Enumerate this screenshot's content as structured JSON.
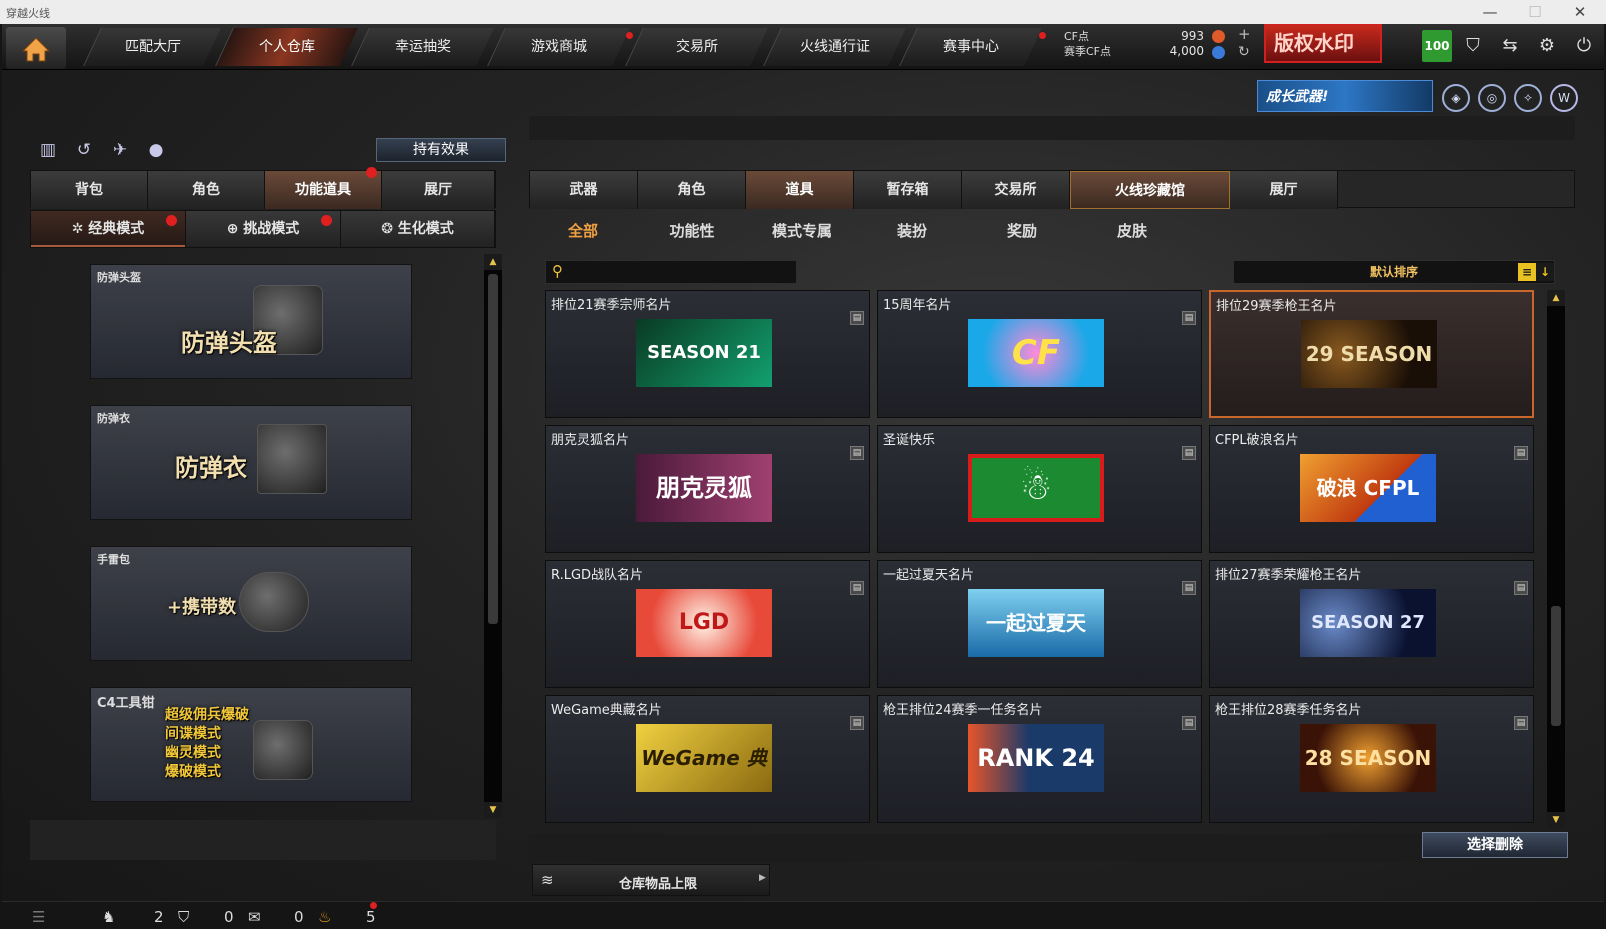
{
  "window": {
    "title": "穿越火线",
    "minimize": "—",
    "maximize": "☐",
    "close": "✕"
  },
  "nav": {
    "tabs": [
      {
        "label": "匹配大厅"
      },
      {
        "label": "个人仓库"
      },
      {
        "label": "幸运抽奖"
      },
      {
        "label": "游戏商城"
      },
      {
        "label": "交易所"
      },
      {
        "label": "火线通行证"
      },
      {
        "label": "赛事中心"
      }
    ],
    "currency": {
      "cf_label": "CF点",
      "cf_value": "993",
      "season_label": "赛季CF点",
      "season_value": "4,000",
      "plus": "+",
      "refresh": "↻"
    },
    "promo": "版权水印",
    "level": "100"
  },
  "banner": {
    "text": "成长武器!"
  },
  "left": {
    "effect_button": "持有效果",
    "tabs": [
      {
        "label": "背包"
      },
      {
        "label": "角色"
      },
      {
        "label": "功能道具"
      },
      {
        "label": "展厅"
      }
    ],
    "modes": [
      {
        "label": "经典模式"
      },
      {
        "label": "挑战模式"
      },
      {
        "label": "生化模式"
      }
    ],
    "items": [
      {
        "label": "防弹头盔",
        "art_text": "防弹头盔"
      },
      {
        "label": "防弹衣",
        "art_text": "防弹衣"
      },
      {
        "label": "手雷包",
        "art_text": "+携带数"
      },
      {
        "label": "C4工具钳",
        "art_lines": [
          "超级佣兵爆破",
          "间谍模式",
          "幽灵模式",
          "爆破模式"
        ]
      }
    ]
  },
  "right": {
    "tabs": [
      {
        "label": "武器"
      },
      {
        "label": "角色"
      },
      {
        "label": "道具"
      },
      {
        "label": "暂存箱"
      },
      {
        "label": "交易所"
      },
      {
        "label": "火线珍藏馆"
      },
      {
        "label": "展厅"
      }
    ],
    "subtabs": [
      {
        "label": "全部"
      },
      {
        "label": "功能性"
      },
      {
        "label": "模式专属"
      },
      {
        "label": "装扮"
      },
      {
        "label": "奖励"
      },
      {
        "label": "皮肤"
      }
    ],
    "search_placeholder": "",
    "sort_label": "默认排序",
    "cards": [
      {
        "name": "排位21赛季宗师名片",
        "art": "SEASON 21",
        "bg": "#0d7a5a"
      },
      {
        "name": "15周年名片",
        "art": "CF",
        "bg": "#2a9ed8"
      },
      {
        "name": "排位29赛季枪王名片",
        "art": "29 SEASON",
        "bg": "#2a1a0c"
      },
      {
        "name": "朋克灵狐名片",
        "art": "朋克灵狐",
        "bg": "#6a2b50"
      },
      {
        "name": "圣诞快乐",
        "art": "☃",
        "bg": "#1b7a2a"
      },
      {
        "name": "CFPL破浪名片",
        "art": "破浪 CFPL",
        "bg": "#d86a18"
      },
      {
        "name": "R.LGD战队名片",
        "art": "LGD",
        "bg": "#e84a3a"
      },
      {
        "name": "一起过夏天名片",
        "art": "一起过夏天",
        "bg": "#2a8ac8"
      },
      {
        "name": "排位27赛季荣耀枪王名片",
        "art": "SEASON 27",
        "bg": "#0c1a3c"
      },
      {
        "name": "WeGame典藏名片",
        "art": "WeGame 典藏",
        "bg": "#b8961a"
      },
      {
        "name": "枪王排位24赛季一任务名片",
        "art": "RANK 24",
        "bg": "#1c3a6a"
      },
      {
        "name": "枪王排位28赛季任务名片",
        "art": "28 SEASON",
        "bg": "#3a1206"
      }
    ],
    "delete_button": "选择删除",
    "capacity_label": "仓库物品上限"
  },
  "bottom": {
    "friends": "2",
    "guild": "0",
    "messages": "0",
    "gifts": "5"
  }
}
